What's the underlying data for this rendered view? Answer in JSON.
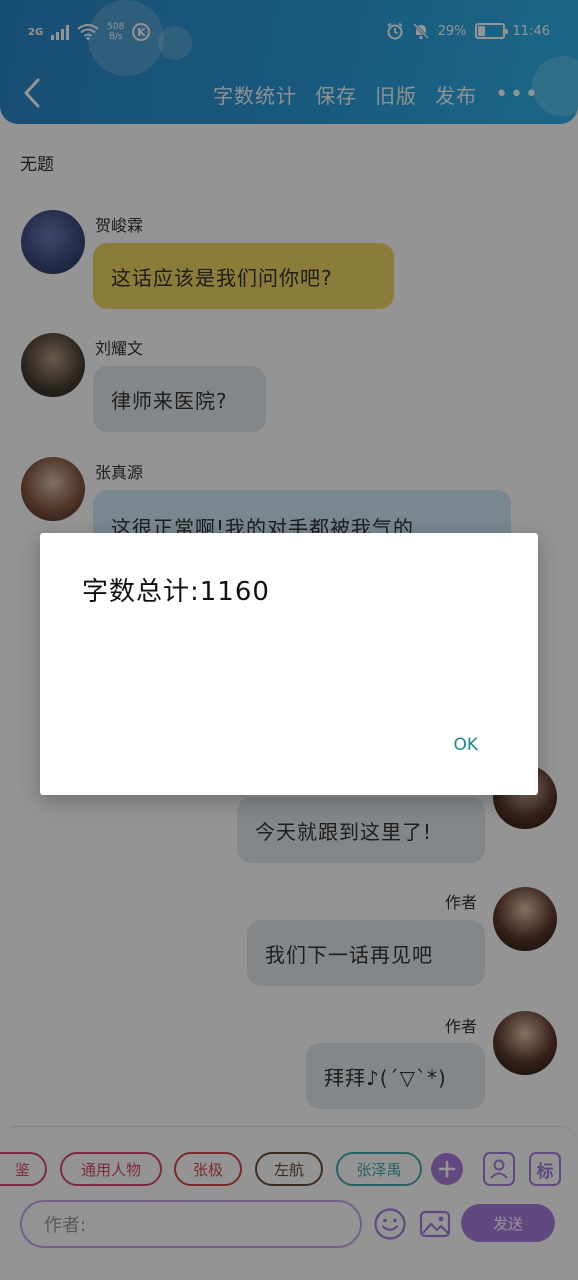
{
  "status_bar": {
    "network": "2G",
    "speed_value": "508",
    "speed_unit": "B/s",
    "k_label": "K",
    "battery": "29%",
    "battery_level": 0.29,
    "time": "11:46"
  },
  "header": {
    "menu": [
      "字数统计",
      "保存",
      "旧版",
      "发布"
    ],
    "more": "•••"
  },
  "conversation": {
    "title": "无题",
    "messages": [
      {
        "name": "贺峻霖",
        "text": "这话应该是我们问你吧?"
      },
      {
        "name": "刘耀文",
        "text": "律师来医院?"
      },
      {
        "name": "张真源",
        "text": "这很正常啊!我的对手都被我气的"
      },
      {
        "name": "",
        "text": "今天就跟到这里了!"
      },
      {
        "name": "作者",
        "text": "我们下一话再见吧"
      },
      {
        "name": "作者",
        "text": "拜拜♪(´▽`*)"
      }
    ]
  },
  "characters": {
    "chips": [
      "鉴",
      "通用人物",
      "张极",
      "左航",
      "张泽禹"
    ],
    "colors": [
      "#d64b6c",
      "#d64b6c",
      "#d64b4b",
      "#6b4a3a",
      "#48a8b0"
    ]
  },
  "composer": {
    "placeholder": "作者:",
    "send_label": "发送",
    "tag_label": "标"
  },
  "dialog": {
    "text": "字数总计:1160",
    "ok_label": "OK"
  },
  "colors": {
    "header": "#2a9bd8",
    "accent": "#a97ddf",
    "dialog_ok": "#138a8a"
  }
}
